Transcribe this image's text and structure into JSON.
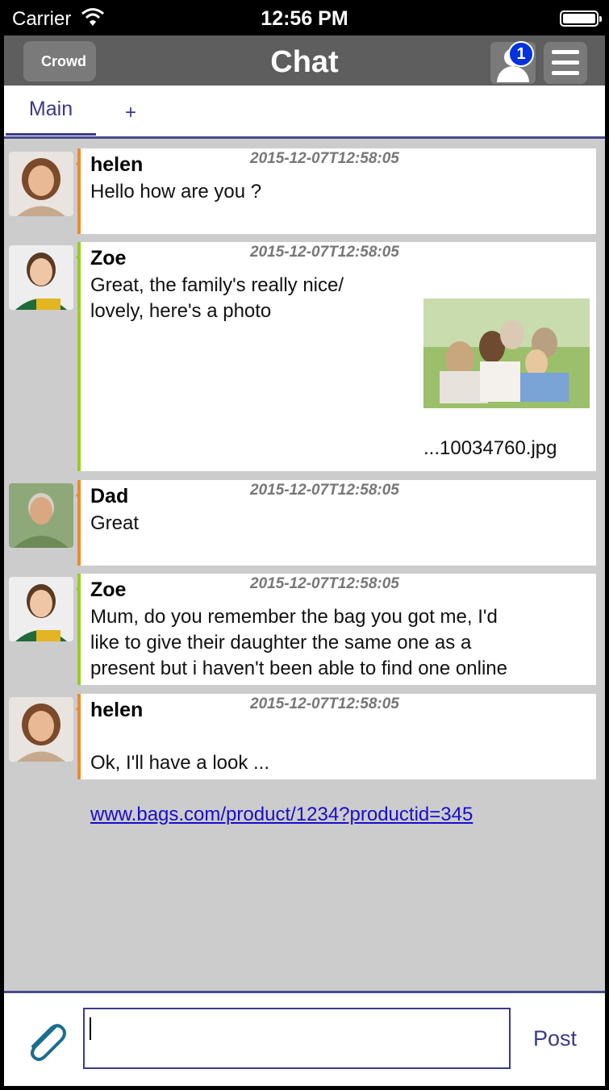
{
  "status_bar": {
    "carrier": "Carrier",
    "time": "12:56 PM"
  },
  "nav": {
    "back_label": "Crowd",
    "title": "Chat",
    "notification_count": "1"
  },
  "tabs": {
    "main_label": "Main",
    "add_label": "+"
  },
  "messages": [
    {
      "author": "helen",
      "timestamp": "2015-12-07T12:58:05",
      "text": "Hello how are you ?",
      "accent": "#f08a2a"
    },
    {
      "author": "Zoe",
      "timestamp": "2015-12-07T12:58:05",
      "text": "Great, the family's really nice/\nlovely, here's a photo",
      "attachment": "...10034760.jpg",
      "accent": "#99cc22"
    },
    {
      "author": "Dad",
      "timestamp": "2015-12-07T12:58:05",
      "text": "Great",
      "accent": "#f08a2a"
    },
    {
      "author": "Zoe",
      "timestamp": "2015-12-07T12:58:05",
      "text": "Mum, do you remember the bag you got me, I'd\nlike to give their daughter the same one as a\npresent but i haven't been able to find one online",
      "accent": "#99cc22"
    },
    {
      "author": "helen",
      "timestamp": "2015-12-07T12:58:05",
      "text": "Ok, I'll have a look ...",
      "link": "www.bags.com/product/1234?productid=345",
      "accent": "#f08a2a"
    }
  ],
  "composer": {
    "value": "",
    "post_label": "Post"
  },
  "colors": {
    "nav_bg": "#5e5e5e",
    "accent_purple": "#3a3a8a",
    "badge_blue": "#0033dd",
    "orange": "#f08a2a",
    "green": "#99cc22"
  }
}
